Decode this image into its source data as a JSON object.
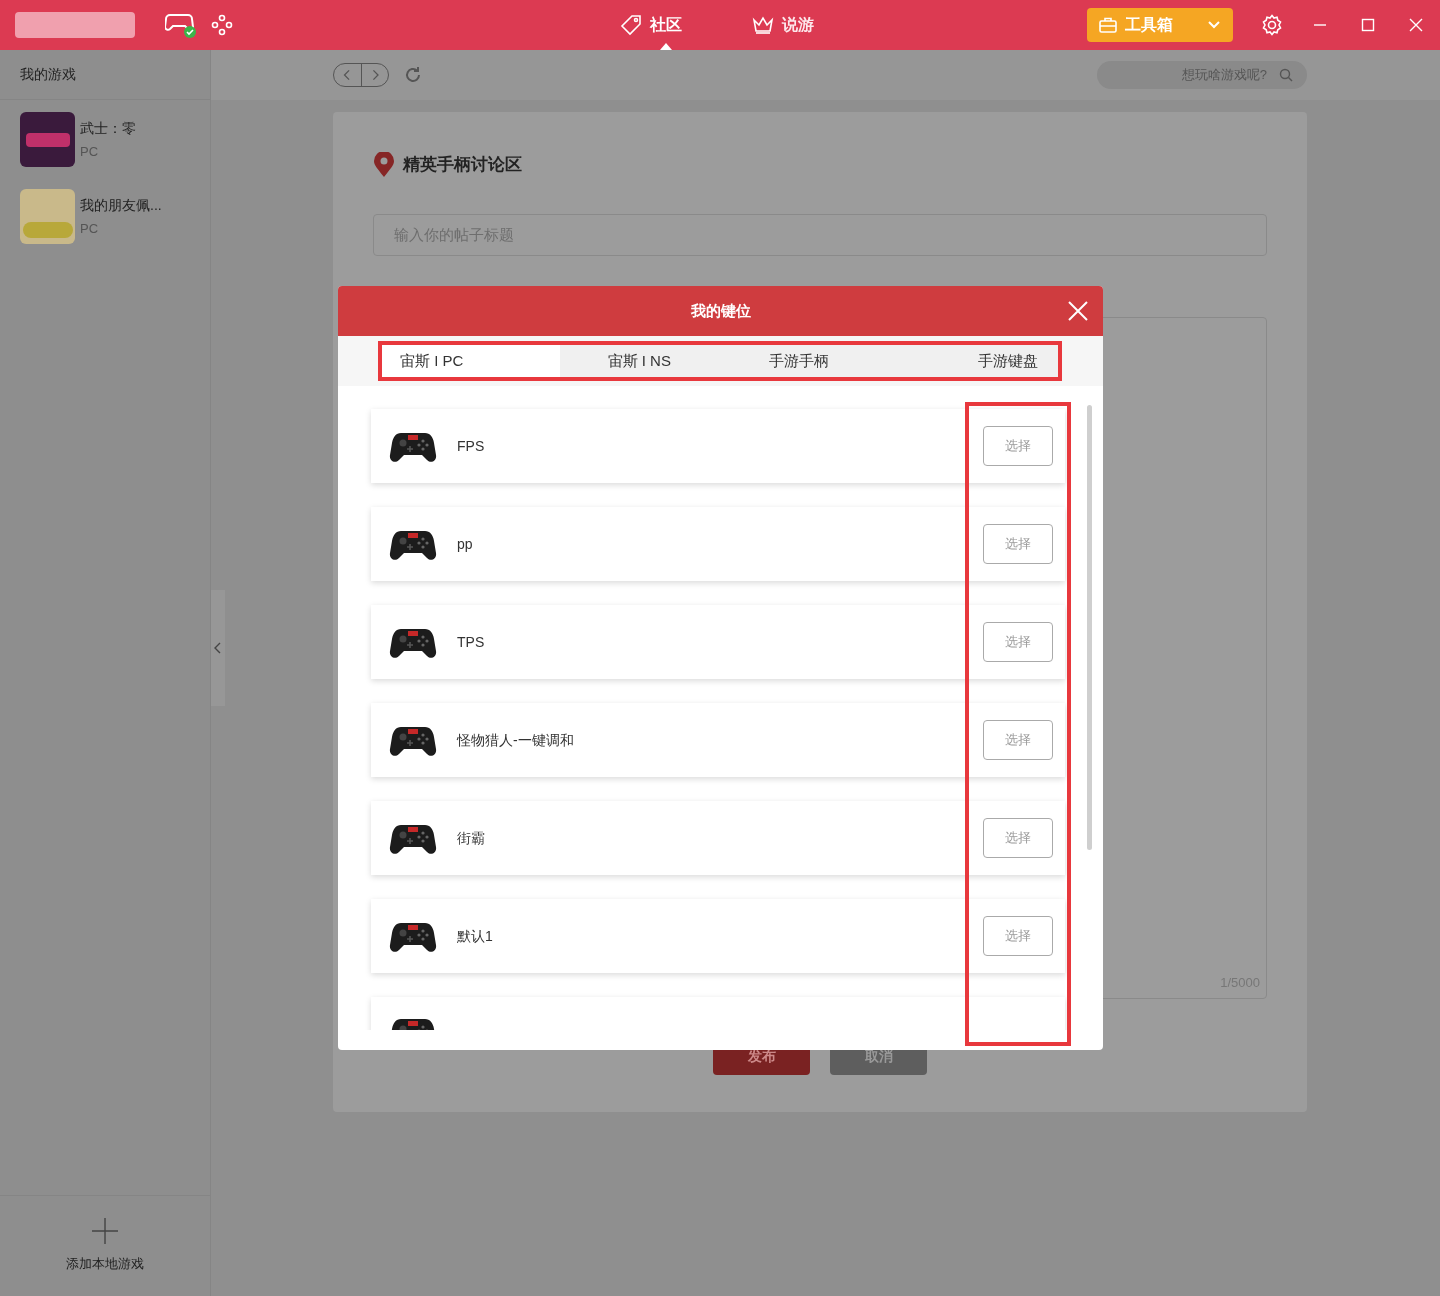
{
  "titlebar": {
    "nav": [
      {
        "label": "社区",
        "selected": true
      },
      {
        "label": "说游",
        "selected": false
      }
    ],
    "toolbox": "工具箱"
  },
  "sidebar": {
    "title": "我的游戏",
    "games": [
      {
        "name": "武士：零",
        "platform": "PC"
      },
      {
        "name": "我的朋友佩...",
        "platform": "PC"
      }
    ],
    "add": "添加本地游戏"
  },
  "search": {
    "placeholder": "想玩啥游戏呢?"
  },
  "post": {
    "forum": "精英手柄讨论区",
    "title_placeholder": "输入你的帖子标题",
    "counter": "1/5000",
    "buttons": [
      {
        "label": "发布",
        "kind": "primary"
      },
      {
        "label": "取消",
        "kind": "secondary"
      }
    ]
  },
  "modal": {
    "title": "我的键位",
    "tabs": [
      {
        "label": "宙斯 I PC",
        "selected": true
      },
      {
        "label": "宙斯 I NS",
        "selected": false
      },
      {
        "label": "手游手柄",
        "selected": false
      },
      {
        "label": "手游键盘",
        "selected": false
      }
    ],
    "presets": [
      {
        "name": "FPS",
        "action": "选择"
      },
      {
        "name": "pp",
        "action": "选择"
      },
      {
        "name": "TPS",
        "action": "选择"
      },
      {
        "name": "怪物猎人-一键调和",
        "action": "选择"
      },
      {
        "name": "街霸",
        "action": "选择"
      },
      {
        "name": "默认1",
        "action": "选择"
      }
    ]
  }
}
